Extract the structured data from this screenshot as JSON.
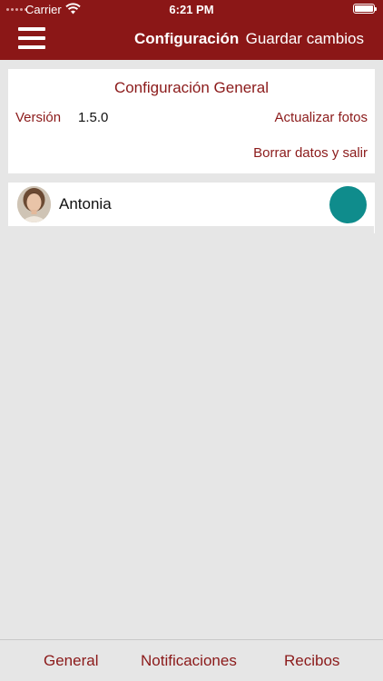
{
  "status_bar": {
    "carrier": "Carrier",
    "time": "6:21 PM",
    "wifi_icon": "wifi-icon",
    "battery_icon": "battery-icon"
  },
  "nav": {
    "menu_icon": "hamburger-menu-icon",
    "title": "Configuración",
    "save_label": "Guardar cambios"
  },
  "general_card": {
    "title": "Configuración General",
    "version_label": "Versión",
    "version_value": "1.5.0",
    "update_photos_label": "Actualizar fotos",
    "clear_data_label": "Borrar datos y salir"
  },
  "users": [
    {
      "name": "Antonia",
      "status_color": "#0f8c8c"
    }
  ],
  "tabs": [
    {
      "label": "General"
    },
    {
      "label": "Notificaciones"
    },
    {
      "label": "Recibos"
    }
  ],
  "colors": {
    "brand": "#8b1717",
    "accent_text": "#8b1a1a",
    "background": "#e6e6e6",
    "status_dot": "#0f8c8c"
  }
}
